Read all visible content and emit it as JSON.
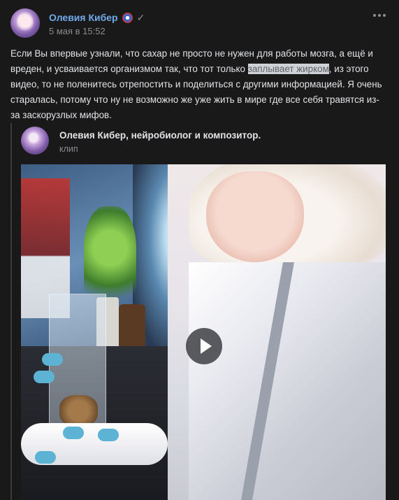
{
  "post": {
    "author": "Олевия Кибер",
    "date": "5 мая в 15:52",
    "text_before": "Если Вы впервые узнали, что сахар не просто не нужен для работы мозга, а ещё и вреден, и усваивается организмом так, что тот только ",
    "text_highlight": "заплывает жирком",
    "text_after": ", из этого видео, то не поленитесь отрепостить и поделиться с другими информацией. Я очень старалась, потому что ну не возможно же уже жить в мире где все себя травятся из-за заскорузлых мифов."
  },
  "repost": {
    "author": "Олевия Кибер, нейробиолог и композитор.",
    "type": "клип"
  },
  "icons": {
    "badge": "captain-shield-icon",
    "verified": "check-icon",
    "more": "more-dots-icon",
    "play": "play-icon"
  },
  "colors": {
    "background": "#19191a",
    "link": "#71aaeb",
    "text": "#e1e3e6",
    "secondary": "#8a8d91"
  }
}
